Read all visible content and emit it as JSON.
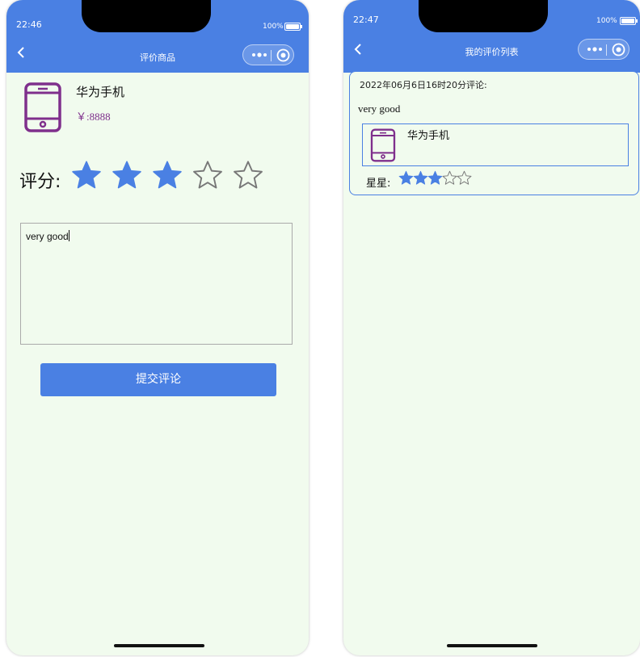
{
  "left_screen": {
    "status_bar": {
      "time": "22:46",
      "battery": "100%"
    },
    "nav": {
      "title": "评价商品"
    },
    "product": {
      "name": "华为手机",
      "price": "￥:8888"
    },
    "rating": {
      "label": "评分:",
      "value": 3,
      "max": 5
    },
    "comment": {
      "value": "very good"
    },
    "submit_label": "提交评论"
  },
  "right_screen": {
    "status_bar": {
      "time": "22:47",
      "battery": "100%"
    },
    "nav": {
      "title": "我的评价列表"
    },
    "review": {
      "date_text": "2022年06月6日16时20分评论:",
      "text": "very good",
      "product_name": "华为手机",
      "stars_label": "星星:",
      "stars_value": 3,
      "stars_max": 5
    }
  },
  "colors": {
    "accent": "#4a80e3",
    "background": "#f1fbee",
    "product_icon": "#7f2f8c",
    "price": "#7f2f8c"
  },
  "icons": [
    "back-chevron",
    "more-dots",
    "record-target",
    "phone-device",
    "star-filled",
    "star-outline",
    "battery"
  ]
}
